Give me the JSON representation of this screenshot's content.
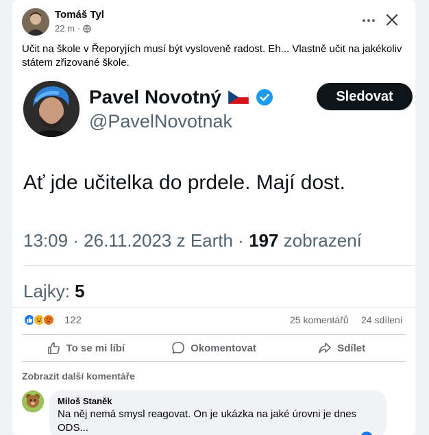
{
  "post": {
    "author": "Tomáš Tyl",
    "time": "22 m",
    "time_separator": "·",
    "text": "Učit na škole v Řeporyjích musí být vysloveně radost. Eh... Vlastně učit na jakékoliv státem zřizované škole."
  },
  "tweet": {
    "name": "Pavel Novotný",
    "flag": "🇨🇿",
    "handle": "@PavelNovotnak",
    "follow_label": "Sledovat",
    "text": "Ať jde učitelka do prdele. Mají dost.",
    "time_source": "13:09 · 26.11.2023 z Earth ·",
    "views_count": "197",
    "views_label": "zobrazení",
    "likes_label": "Lajky:",
    "likes_count": "5"
  },
  "stats": {
    "reactions": "122",
    "comments": "25 komentářů",
    "shares": "24 sdílení"
  },
  "actions": {
    "like": "To se mi líbí",
    "comment": "Okomentovat",
    "share": "Sdílet"
  },
  "comments": {
    "more_label": "Zobrazit další komentáře",
    "items": [
      {
        "author": "Miloš Staněk",
        "text": "Na něj nemá smysl reagovat. On je ukázka na jaké úrovni je dnes ODS..."
      }
    ]
  },
  "colors": {
    "brand_blue": "#1877f2",
    "follow_button": "#0f1419",
    "verified": "#1d9bf0"
  }
}
